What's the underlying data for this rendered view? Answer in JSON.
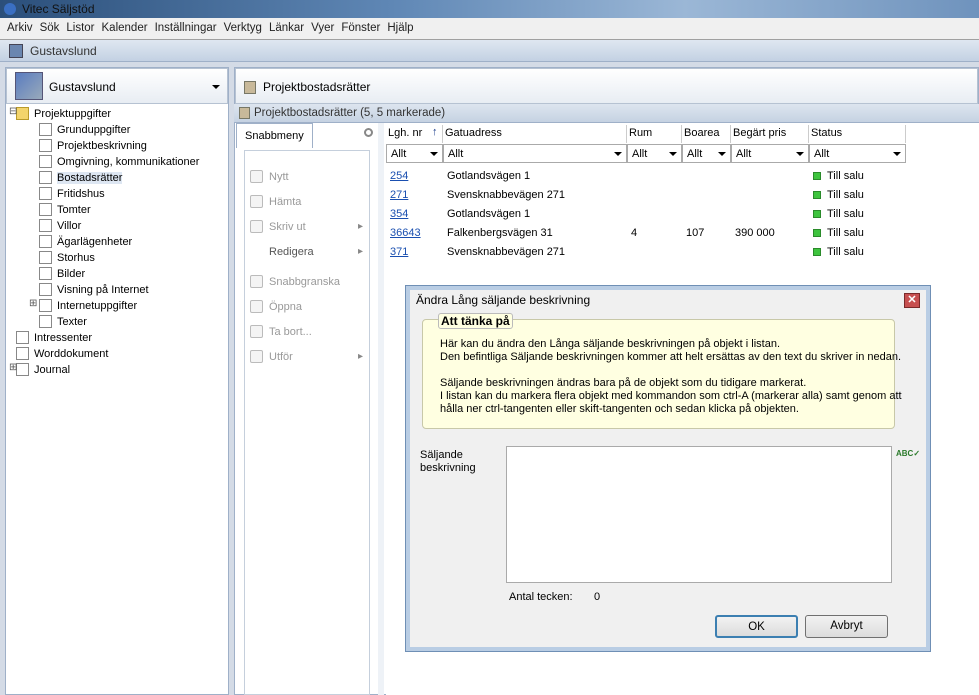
{
  "app": {
    "title": "Vitec Säljstöd"
  },
  "menu": [
    "Arkiv",
    "Sök",
    "Listor",
    "Kalender",
    "Inställningar",
    "Verktyg",
    "Länkar",
    "Vyer",
    "Fönster",
    "Hjälp"
  ],
  "project_bar": "Gustavslund",
  "left_panel": {
    "title": "Gustavslund",
    "tree": [
      {
        "label": "Projektuppgifter",
        "level": 0,
        "expander": "minus"
      },
      {
        "label": "Grunduppgifter",
        "level": 1
      },
      {
        "label": "Projektbeskrivning",
        "level": 1
      },
      {
        "label": "Omgivning, kommunikationer",
        "level": 1
      },
      {
        "label": "Bostadsrätter",
        "level": 1,
        "selected": true
      },
      {
        "label": "Fritidshus",
        "level": 1
      },
      {
        "label": "Tomter",
        "level": 1
      },
      {
        "label": "Villor",
        "level": 1
      },
      {
        "label": "Ägarlägenheter",
        "level": 1
      },
      {
        "label": "Storhus",
        "level": 1
      },
      {
        "label": "Bilder",
        "level": 1
      },
      {
        "label": "Visning på Internet",
        "level": 1
      },
      {
        "label": "Internetuppgifter",
        "level": 1,
        "expander": "plus"
      },
      {
        "label": "Texter",
        "level": 1
      },
      {
        "label": "Intressenter",
        "level": 0
      },
      {
        "label": "Worddokument",
        "level": 0
      },
      {
        "label": "Journal",
        "level": 0,
        "expander": "plus"
      }
    ]
  },
  "right_panel": {
    "title": "Projektbostadsrätter",
    "grid_title": "Projektbostadsrätter (5, 5 markerade)"
  },
  "snabbmeny": {
    "tab": "Snabbmeny",
    "items": [
      {
        "label": "Nytt",
        "submenu": false
      },
      {
        "label": "Hämta",
        "submenu": false
      },
      {
        "label": "Skriv ut",
        "submenu": true
      },
      {
        "label": "Redigera",
        "submenu": true
      },
      {
        "label": "Snabbgranska",
        "submenu": false
      },
      {
        "label": "Öppna",
        "submenu": false
      },
      {
        "label": "Ta bort...",
        "submenu": false
      },
      {
        "label": "Utför",
        "submenu": true
      }
    ]
  },
  "grid": {
    "columns": [
      "Lgh. nr",
      "Gatuadress",
      "Rum",
      "Boarea",
      "Begärt pris",
      "Status"
    ],
    "filters": [
      "Allt",
      "Allt",
      "Allt",
      "Allt",
      "Allt",
      "Allt"
    ],
    "rows": [
      [
        "254",
        "Gotlandsvägen 1",
        "",
        "",
        "",
        "Till salu"
      ],
      [
        "271",
        "Svensknabbevägen 271",
        "",
        "",
        "",
        "Till salu"
      ],
      [
        "354",
        "Gotlandsvägen 1",
        "",
        "",
        "",
        "Till salu"
      ],
      [
        "36643",
        "Falkenbergsvägen 31",
        "4",
        "107",
        "390 000",
        "Till salu"
      ],
      [
        "371",
        "Svensknabbevägen 271",
        "",
        "",
        "",
        "Till salu"
      ]
    ]
  },
  "dialog": {
    "title": "Ändra Lång säljande beskrivning",
    "info_title": "Att tänka på",
    "info_lines": [
      "Här kan du ändra den Långa säljande beskrivningen på objekt i listan.",
      "Den befintliga Säljande beskrivningen kommer att helt ersättas av den text du skriver in nedan.",
      "",
      "Säljande beskrivningen ändras bara på de objekt som du tidigare markerat.",
      "I listan kan du markera flera objekt med kommandon som ctrl-A (markerar alla) samt genom att",
      "hålla ner ctrl-tangenten eller skift-tangenten och sedan klicka på objekten."
    ],
    "field_label_1": "Säljande",
    "field_label_2": "beskrivning",
    "field_value": "",
    "count_label": "Antal tecken:",
    "count_value": "0",
    "ok": "OK",
    "cancel": "Avbryt"
  }
}
